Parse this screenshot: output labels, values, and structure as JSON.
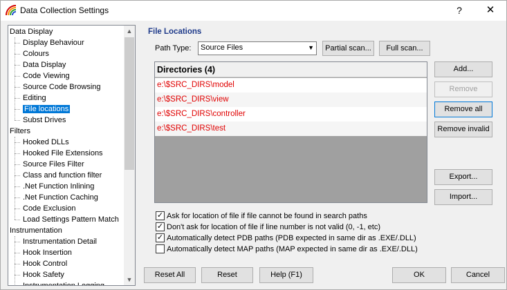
{
  "window": {
    "title": "Data Collection Settings",
    "help": "?",
    "close": "✕"
  },
  "tree": {
    "items": [
      {
        "label": "Data Display",
        "level": 0
      },
      {
        "label": "Display Behaviour",
        "level": 1
      },
      {
        "label": "Colours",
        "level": 1
      },
      {
        "label": "Data Display",
        "level": 1
      },
      {
        "label": "Code Viewing",
        "level": 1
      },
      {
        "label": "Source Code Browsing",
        "level": 1
      },
      {
        "label": "Editing",
        "level": 1
      },
      {
        "label": "File locations",
        "level": 1,
        "selected": true
      },
      {
        "label": "Subst Drives",
        "level": 1
      },
      {
        "label": "Filters",
        "level": 0
      },
      {
        "label": "Hooked DLLs",
        "level": 1
      },
      {
        "label": "Hooked File Extensions",
        "level": 1
      },
      {
        "label": "Source Files Filter",
        "level": 1
      },
      {
        "label": "Class and function filter",
        "level": 1
      },
      {
        "label": ".Net Function Inlining",
        "level": 1
      },
      {
        "label": ".Net Function Caching",
        "level": 1
      },
      {
        "label": "Code Exclusion",
        "level": 1
      },
      {
        "label": "Load Settings Pattern Match",
        "level": 1
      },
      {
        "label": "Instrumentation",
        "level": 0
      },
      {
        "label": "Instrumentation Detail",
        "level": 1
      },
      {
        "label": "Hook Insertion",
        "level": 1
      },
      {
        "label": "Hook Control",
        "level": 1
      },
      {
        "label": "Hook Safety",
        "level": 1
      },
      {
        "label": "Instrumentation Logging",
        "level": 1
      }
    ]
  },
  "main": {
    "section_title": "File Locations",
    "path_type_label": "Path Type:",
    "path_type_value": "Source Files",
    "partial_scan": "Partial scan...",
    "full_scan": "Full scan...",
    "dir_header": "Directories (4)",
    "directories": [
      "e:\\$SRC_DIRS\\model",
      "e:\\$SRC_DIRS\\view",
      "e:\\$SRC_DIRS\\controller",
      "e:\\$SRC_DIRS\\test"
    ],
    "add": "Add...",
    "remove": "Remove",
    "remove_all": "Remove all",
    "remove_invalid": "Remove invalid",
    "export": "Export...",
    "import": "Import...",
    "checks": [
      {
        "label": "Ask for location of file if file cannot be found in search paths",
        "checked": true
      },
      {
        "label": "Don't ask for location of file if line number is not valid (0, -1, etc)",
        "checked": true
      },
      {
        "label": "Automatically detect PDB paths (PDB expected in same dir as .EXE/.DLL)",
        "checked": true
      },
      {
        "label": "Automatically detect MAP paths (MAP expected in same dir as .EXE/.DLL)",
        "checked": false
      }
    ]
  },
  "footer": {
    "reset_all": "Reset All",
    "reset": "Reset",
    "help": "Help (F1)",
    "ok": "OK",
    "cancel": "Cancel"
  },
  "colors": {
    "accent": "#0078d7",
    "title_blue": "#1e3a8a",
    "dir_text": "#e00000"
  }
}
